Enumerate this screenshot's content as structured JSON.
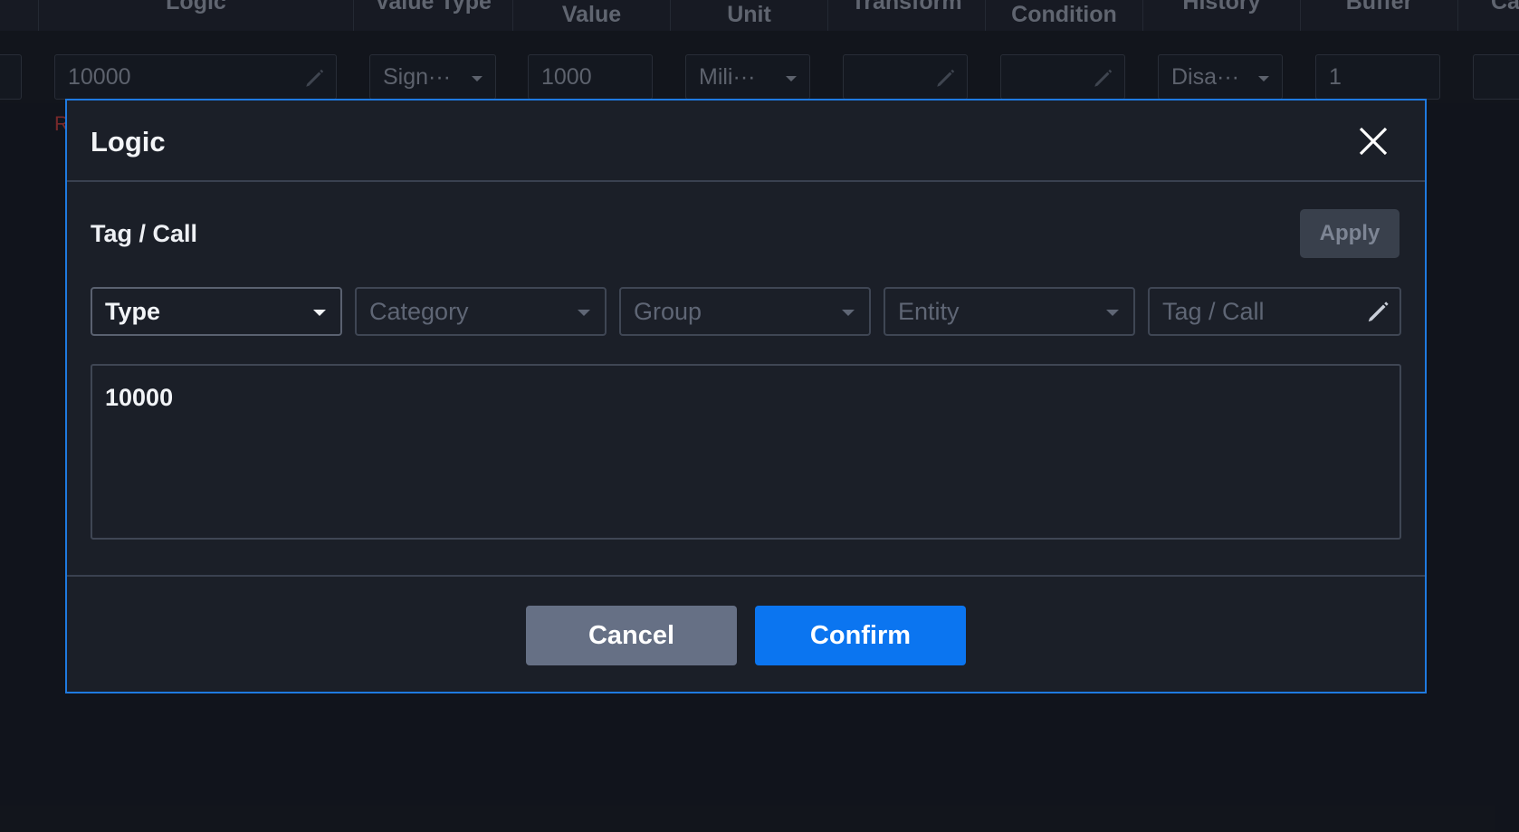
{
  "table": {
    "headers": [
      "Logic",
      "Value Type",
      "Value",
      "Unit",
      "Transform",
      "Condition",
      "History",
      "Buffer",
      "Ca"
    ],
    "row": {
      "logic": "10000",
      "value_type": "Sign···",
      "value": "1000",
      "unit": "Mili···",
      "transform": "",
      "condition": "",
      "history": "Disa···",
      "buffer": "1",
      "error_mark": "R"
    }
  },
  "modal": {
    "title": "Logic",
    "section_label": "Tag / Call",
    "apply_label": "Apply",
    "filters": {
      "type": "Type",
      "category_placeholder": "Category",
      "group_placeholder": "Group",
      "entity_placeholder": "Entity",
      "tag_placeholder": "Tag / Call"
    },
    "editor_value": "10000",
    "cancel_label": "Cancel",
    "confirm_label": "Confirm"
  },
  "colors": {
    "accent": "#0b75f0",
    "modal_border": "#1f7ae0",
    "cancel": "#667085",
    "background": "#161a22"
  },
  "icons": {
    "close": "close-icon",
    "edit": "pencil-icon",
    "dropdown": "caret-down-icon"
  }
}
